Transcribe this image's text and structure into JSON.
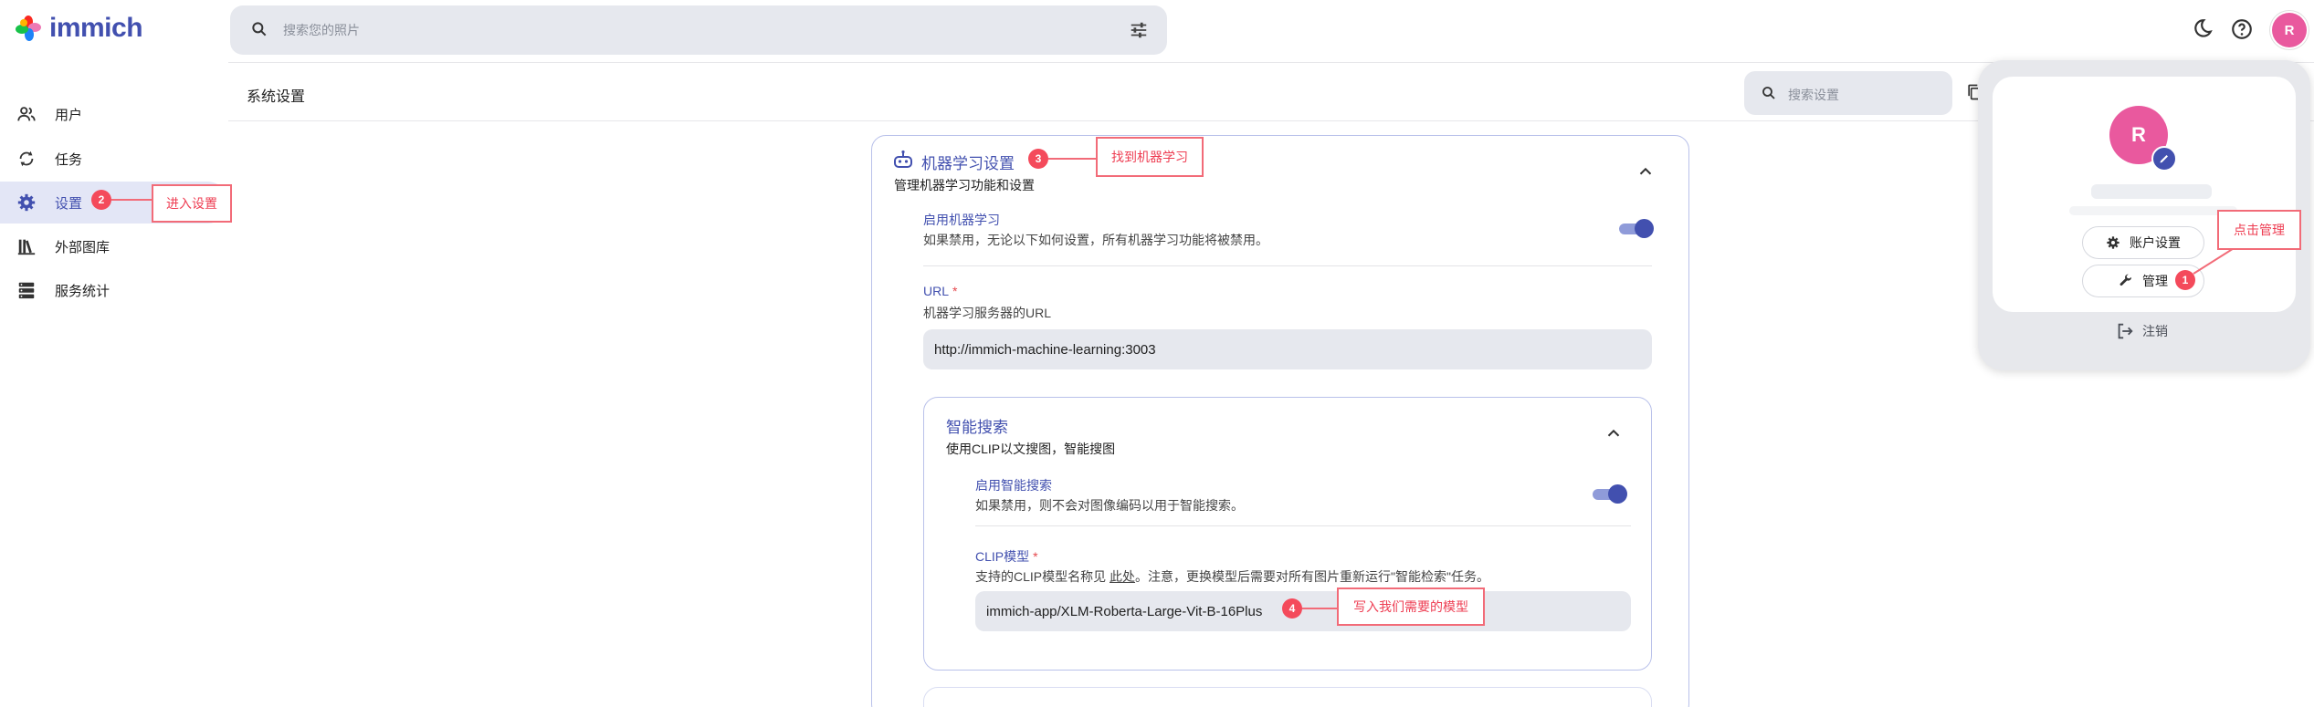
{
  "app": {
    "name": "immich"
  },
  "search": {
    "placeholder": "搜索您的照片"
  },
  "user": {
    "initial": "R"
  },
  "sidebar": {
    "items": [
      {
        "label": "用户",
        "icon": "users-icon",
        "active": false
      },
      {
        "label": "任务",
        "icon": "sync-icon",
        "active": false
      },
      {
        "label": "设置",
        "icon": "gear-icon",
        "active": true
      },
      {
        "label": "外部图库",
        "icon": "library-icon",
        "active": false
      },
      {
        "label": "服务统计",
        "icon": "server-icon",
        "active": false
      }
    ]
  },
  "page": {
    "title": "系统设置",
    "search_placeholder": "搜索设置"
  },
  "ml_settings": {
    "title": "机器学习设置",
    "subtitle": "管理机器学习功能和设置",
    "enable": {
      "label": "启用机器学习",
      "description": "如果禁用，无论以下如何设置，所有机器学习功能将被禁用。",
      "on": true
    },
    "url": {
      "label": "URL",
      "required": "*",
      "description": "机器学习服务器的URL",
      "value": "http://immich-machine-learning:3003"
    },
    "smart_search": {
      "title": "智能搜索",
      "subtitle": "使用CLIP以文搜图，智能搜图",
      "enable": {
        "label": "启用智能搜索",
        "description": "如果禁用，则不会对图像编码以用于智能搜索。",
        "on": true
      },
      "clip": {
        "label": "CLIP模型",
        "required": "*",
        "description_before": "支持的CLIP模型名称见",
        "link": "此处",
        "description_after": "。注意，更换模型后需要对所有图片重新运行\"智能检索\"任务。",
        "value": "immich-app/XLM-Roberta-Large-Vit-B-16Plus"
      }
    }
  },
  "account_menu": {
    "initial": "R",
    "account_settings": "账户设置",
    "admin": "管理",
    "logout": "注销"
  },
  "annotations": [
    {
      "number": "1",
      "text": "点击管理"
    },
    {
      "number": "2",
      "text": "进入设置"
    },
    {
      "number": "3",
      "text": "找到机器学习"
    },
    {
      "number": "4",
      "text": "写入我们需要的模型"
    }
  ],
  "colors": {
    "accent": "#4250af",
    "avatar": "#e9599e",
    "annotation": "#f44a5b"
  }
}
